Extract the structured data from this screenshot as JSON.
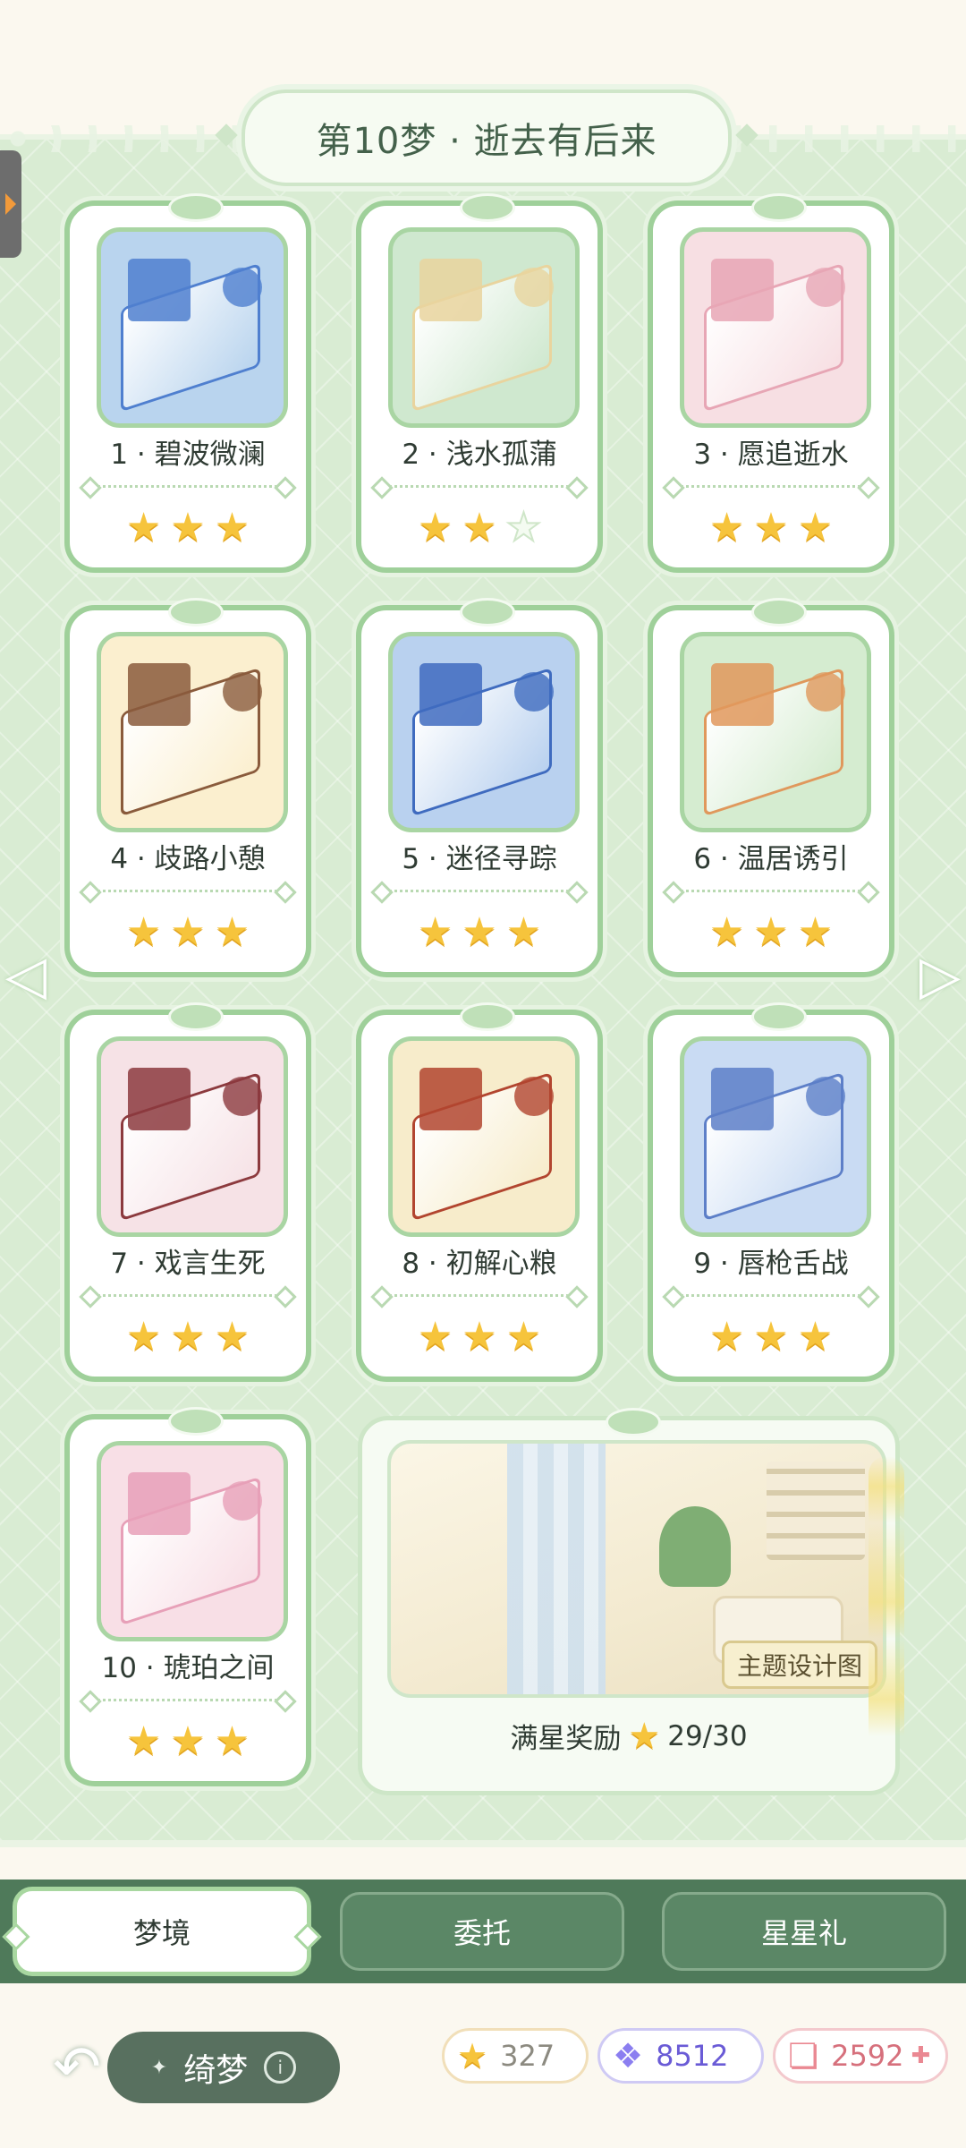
{
  "header": {
    "title": "第10梦 · 逝去有后来"
  },
  "levels": [
    {
      "name": "1 · 碧波微澜",
      "stars_earned": 3,
      "stars_total": 3,
      "theme": "#b9d4ee",
      "accent": "#4f7fcf"
    },
    {
      "name": "2 · 浅水孤蒲",
      "stars_earned": 2,
      "stars_total": 3,
      "theme": "#cfe8cf",
      "accent": "#e9d49e"
    },
    {
      "name": "3 · 愿追逝水",
      "stars_earned": 3,
      "stars_total": 3,
      "theme": "#f7dfe3",
      "accent": "#e7a6b5"
    },
    {
      "name": "4 · 歧路小憩",
      "stars_earned": 3,
      "stars_total": 3,
      "theme": "#fbefcf",
      "accent": "#8a5b3c"
    },
    {
      "name": "5 · 迷径寻踪",
      "stars_earned": 3,
      "stars_total": 3,
      "theme": "#b9d1ef",
      "accent": "#3f6bbf"
    },
    {
      "name": "6 · 温居诱引",
      "stars_earned": 3,
      "stars_total": 3,
      "theme": "#d5ecd0",
      "accent": "#e0985c"
    },
    {
      "name": "7 · 戏言生死",
      "stars_earned": 3,
      "stars_total": 3,
      "theme": "#f6e2e6",
      "accent": "#8c3a3e"
    },
    {
      "name": "8 · 初解心粮",
      "stars_earned": 3,
      "stars_total": 3,
      "theme": "#f7eccb",
      "accent": "#b2452f"
    },
    {
      "name": "9 · 唇枪舌战",
      "stars_earned": 3,
      "stars_total": 3,
      "theme": "#c9dbf3",
      "accent": "#5d7fc8"
    },
    {
      "name": "10 · 琥珀之间",
      "stars_earned": 3,
      "stars_total": 3,
      "theme": "#f8dfe6",
      "accent": "#e7a0b8"
    }
  ],
  "reward": {
    "image_tag": "主题设计图",
    "label": "满星奖励",
    "progress": "29/30",
    "stars_collected": 29,
    "stars_total": 30
  },
  "tabs": [
    {
      "label": "梦境",
      "active": true
    },
    {
      "label": "委托",
      "active": false
    },
    {
      "label": "星星礼",
      "active": false
    }
  ],
  "bottom": {
    "title": "绮梦",
    "info_icon": "i",
    "currencies": [
      {
        "icon": "star-icon",
        "value": "327"
      },
      {
        "icon": "gem-icon",
        "value": "8512"
      },
      {
        "icon": "ticket-icon",
        "value": "2592"
      }
    ]
  },
  "colors": {
    "brand_green": "#4f7a5a",
    "card_border": "#9fd09a",
    "star_gold": "#f6c43c"
  }
}
